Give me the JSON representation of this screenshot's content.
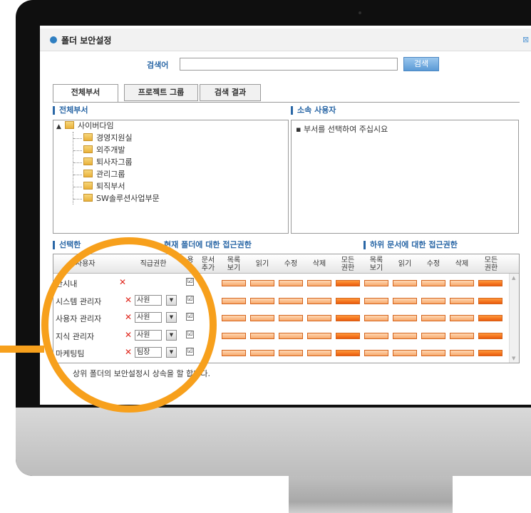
{
  "dialog": {
    "title": "폴더 보안설정"
  },
  "search": {
    "label": "검색어",
    "value": "",
    "button_label": "검색"
  },
  "tabs": [
    {
      "label": "전체부서",
      "active": true
    },
    {
      "label": "프로젝트 그룹",
      "active": false
    },
    {
      "label": "검색 결과",
      "active": false
    }
  ],
  "departments": {
    "section_title": "전체부서",
    "root": "사이버다임",
    "children": [
      "경영지원실",
      "외주개발",
      "퇴사자그룹",
      "관리그룹",
      "퇴직부서",
      "SW솔루션사업부문"
    ]
  },
  "users": {
    "section_title": "소속 사용자",
    "message": "▪ 부서를 선택하여 주십시요"
  },
  "permissions": {
    "section_title_left": "선택한",
    "section_title_mid": "현재 폴더에 대한 접근권한",
    "section_title_right": "하위 문서에 대한 접근권한",
    "headers": {
      "name": "/사용자",
      "position": "직급권한",
      "apply": "용\n수",
      "add_doc": "문서\n추가",
      "list_view": "목록\n보기",
      "read": "읽기",
      "edit": "수정",
      "delete": "삭제",
      "all": "모든\n권한",
      "sub_list_view": "목록\n보기",
      "sub_read": "읽기",
      "sub_edit": "수정",
      "sub_delete": "삭제",
      "sub_all": "모든\n권한"
    },
    "rows": [
      {
        "name": "안시내",
        "position": "",
        "checked": true,
        "check_mark": "☑"
      },
      {
        "name": "시스템 관리자",
        "position": "사원",
        "checked": true,
        "check_mark": "☑"
      },
      {
        "name": "사용자 관리자",
        "position": "사원",
        "checked": true,
        "check_mark": "☑"
      },
      {
        "name": "지식 관리자",
        "position": "사원",
        "checked": true,
        "check_mark": "☑"
      },
      {
        "name": "마케팅팀",
        "position": "팀장",
        "checked": true,
        "check_mark": "☑"
      }
    ],
    "delete_glyph": "✕",
    "select_arrow": "▼"
  },
  "notice": {
    "line1": "상위 폴더의 보안설정시 상속을 할 합니다.",
    "line2": ""
  },
  "colors": {
    "accent": "#2a67a6",
    "highlight": "#f7a01c",
    "bar_light": "#f7a86b",
    "bar_dark": "#ea5b0c"
  }
}
